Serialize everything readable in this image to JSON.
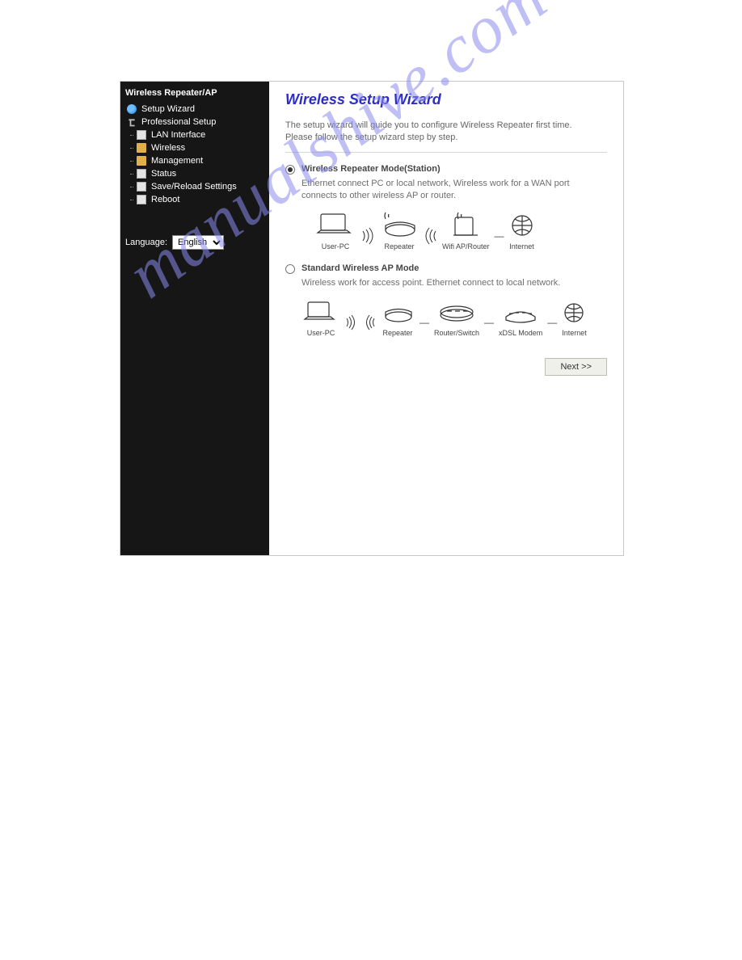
{
  "sidebar": {
    "title": "Wireless Repeater/AP",
    "setup_wizard": "Setup Wizard",
    "professional_setup": "Professional Setup",
    "items": {
      "lan": "LAN Interface",
      "wireless": "Wireless",
      "management": "Management",
      "status": "Status",
      "save_reload": "Save/Reload Settings",
      "reboot": "Reboot"
    },
    "language_label": "Language:",
    "language_value": "English"
  },
  "content": {
    "heading": "Wireless Setup Wizard",
    "intro_line1": "The setup wizard will guide you to configure Wireless Repeater first time.",
    "intro_line2": "Please follow the setup wizard step by step.",
    "option1": {
      "title": "Wireless Repeater Mode(Station)",
      "desc": "Ethernet connect PC or local network, Wireless work for a WAN port connects to other wireless AP or router.",
      "labels": {
        "userpc": "User-PC",
        "repeater": "Repeater",
        "wifiap": "Wifi AP/Router",
        "internet": "Internet"
      }
    },
    "option2": {
      "title": "Standard Wireless AP Mode",
      "desc": "Wireless work for access point. Ethernet connect to local network.",
      "labels": {
        "userpc": "User-PC",
        "repeater": "Repeater",
        "router": "Router/Switch",
        "modem": "xDSL Modem",
        "internet": "Internet"
      }
    },
    "next_button": "Next >>"
  },
  "watermark": "manualshive.com"
}
